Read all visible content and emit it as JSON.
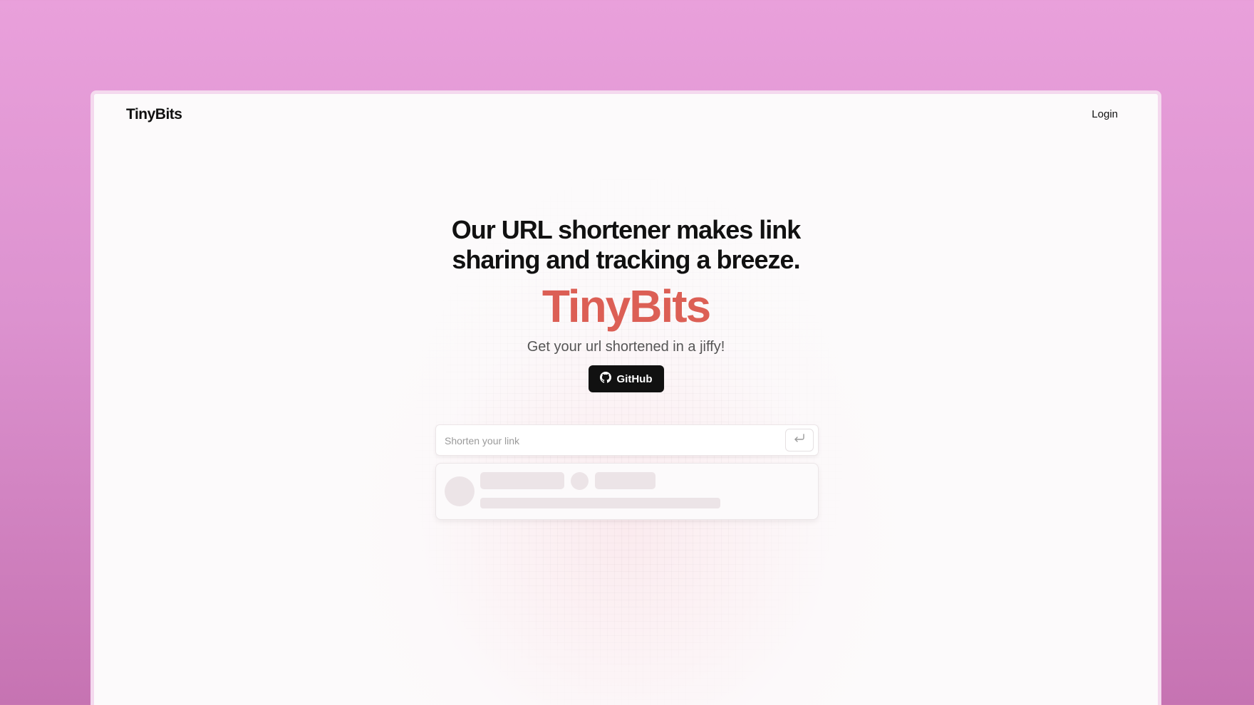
{
  "nav": {
    "brand": "TinyBits",
    "login_label": "Login"
  },
  "hero": {
    "headline": "Our URL shortener makes link sharing and tracking a breeze.",
    "logo_text": "TinyBits",
    "tagline": "Get your url shortened in a jiffy!",
    "github_label": "GitHub"
  },
  "shortener": {
    "placeholder": "Shorten your link",
    "value": ""
  },
  "colors": {
    "accent": "#dc5f55",
    "background_top": "#e9a0db",
    "background_bottom": "#c673b2",
    "button": "#111111"
  },
  "icons": {
    "github": "github-icon",
    "submit": "enter-return-icon"
  }
}
